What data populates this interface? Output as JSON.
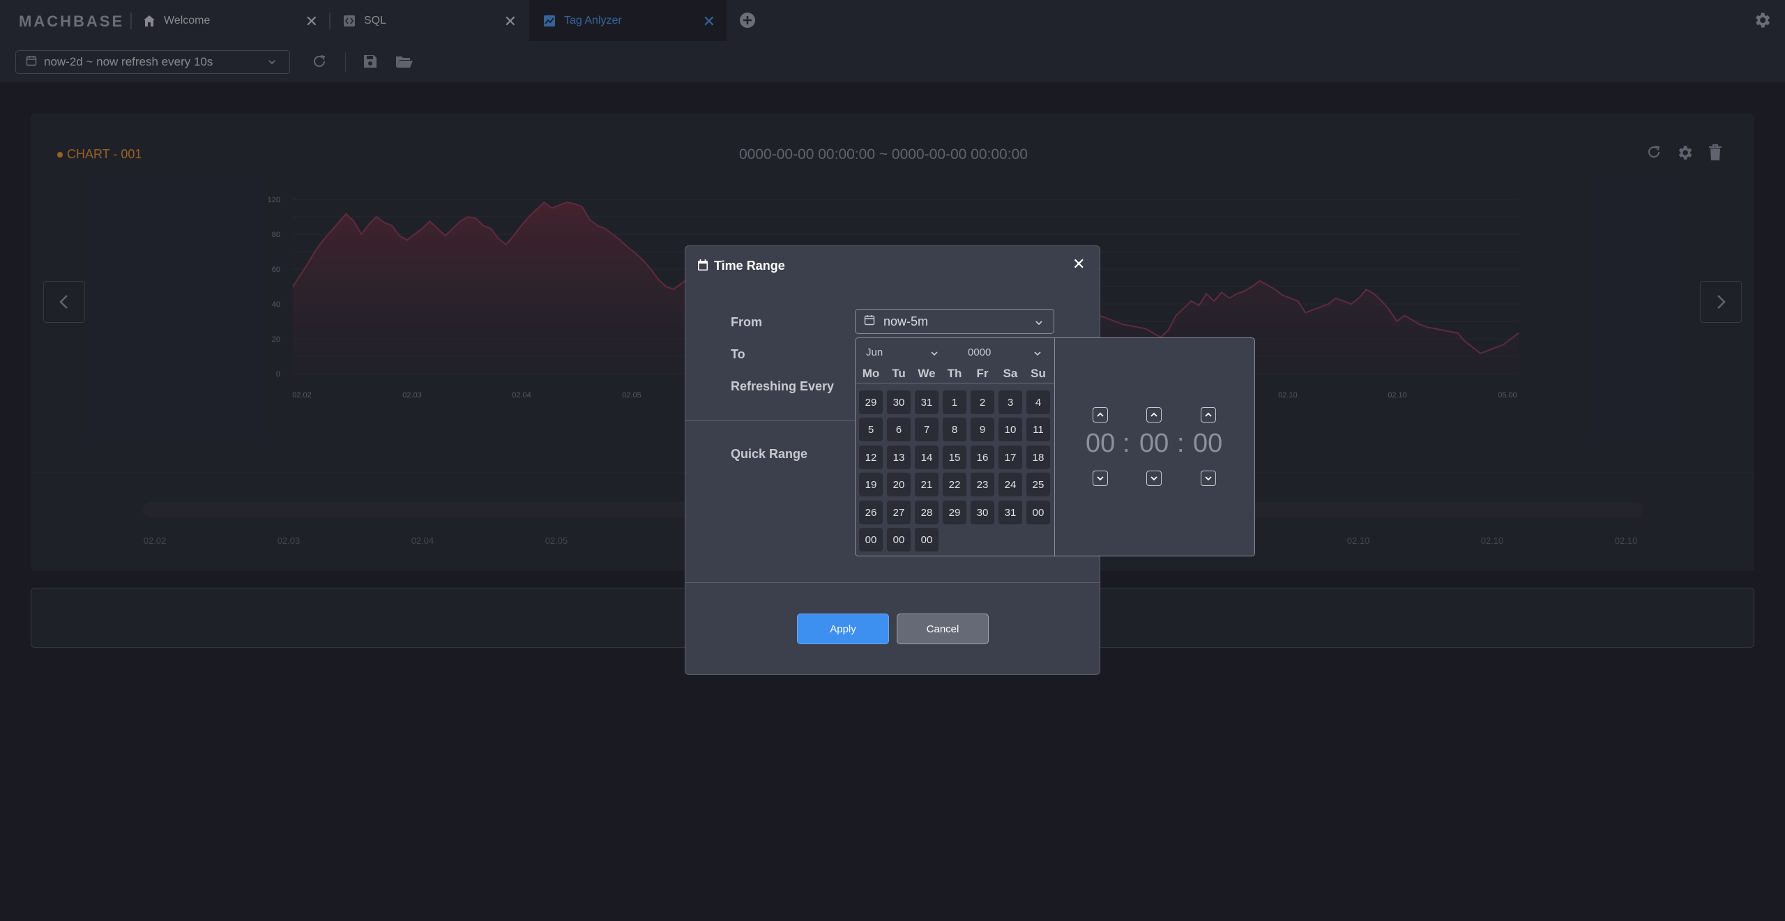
{
  "app": {
    "logo_text": "MACHBASE"
  },
  "tabs": [
    {
      "label": "Welcome",
      "icon": "home-icon",
      "active": false
    },
    {
      "label": "SQL",
      "icon": "sql-icon",
      "active": false
    },
    {
      "label": "Tag Anlyzer",
      "icon": "chart-icon",
      "active": true
    }
  ],
  "toolbar": {
    "range_label": "now-2d ~ now refresh every 10s"
  },
  "panel": {
    "title": "CHART - 001",
    "range_text": "0000-00-00 00:00:00 ~ 0000-00-00 00:00:00",
    "accent": "#e08a2e"
  },
  "chart_data": {
    "type": "area",
    "color": "#6b2c3c",
    "yticks": [
      "120",
      "80",
      "60",
      "40",
      "20",
      "0"
    ],
    "xticks": [
      "02.02",
      "02.03",
      "02.04",
      "02.05",
      "02.10",
      "02.10",
      "05.00"
    ],
    "navigator_ticks": [
      "02.02",
      "02.03",
      "02.04",
      "02.05",
      "02.10",
      "02.10",
      "02.10"
    ],
    "ylim": [
      0,
      120
    ],
    "series_values": [
      60,
      68,
      76,
      85,
      92,
      98,
      104,
      110,
      105,
      96,
      103,
      108,
      104,
      102,
      95,
      92,
      96,
      100,
      105,
      100,
      95,
      100,
      105,
      108,
      107,
      102,
      100,
      93,
      89,
      95,
      102,
      108,
      113,
      118,
      114,
      116,
      118,
      117,
      115,
      106,
      102,
      100,
      96,
      92,
      87,
      83,
      78,
      72,
      65,
      60,
      58,
      62,
      66,
      70,
      68,
      64,
      60,
      55,
      50,
      42,
      36,
      40,
      46,
      52,
      58,
      64,
      68,
      72,
      76,
      80,
      84,
      66,
      62,
      57,
      52,
      48,
      45,
      42,
      40,
      38,
      36,
      34,
      33,
      32,
      34,
      36,
      40,
      45,
      48,
      50,
      52,
      50,
      54,
      58,
      56,
      60,
      62,
      64,
      66,
      62,
      58,
      55,
      52,
      48,
      44,
      42,
      40,
      38,
      36,
      34,
      33,
      32,
      31,
      28,
      25,
      30,
      40,
      45,
      50,
      47,
      55,
      50,
      56,
      52,
      55,
      57,
      60,
      64,
      61,
      58,
      54,
      52,
      50,
      42,
      44,
      46,
      48,
      52,
      50,
      48,
      52,
      58,
      55,
      50,
      44,
      36,
      40,
      37,
      34,
      32,
      31,
      30,
      29,
      28,
      22,
      18,
      14,
      16,
      18,
      20,
      24,
      28
    ]
  },
  "dialog": {
    "title": "Time Range",
    "from_label": "From",
    "to_label": "To",
    "refresh_label": "Refreshing Every",
    "quick_range_label": "Quick Range",
    "from_value": "now-5m",
    "apply_label": "Apply",
    "cancel_label": "Cancel",
    "picker": {
      "month": "Jun",
      "year": "0000",
      "weekdays": [
        "Mo",
        "Tu",
        "We",
        "Th",
        "Fr",
        "Sa",
        "Su"
      ],
      "days": [
        [
          "29",
          "30",
          "31",
          "1",
          "2",
          "3",
          "4"
        ],
        [
          "5",
          "6",
          "7",
          "8",
          "9",
          "10",
          "11"
        ],
        [
          "12",
          "13",
          "14",
          "15",
          "16",
          "17",
          "18"
        ],
        [
          "19",
          "20",
          "21",
          "22",
          "23",
          "24",
          "25"
        ],
        [
          "26",
          "27",
          "28",
          "29",
          "30",
          "31",
          "00"
        ],
        [
          "00",
          "00",
          "00"
        ]
      ],
      "hours": "00",
      "minutes": "00",
      "seconds": "00"
    }
  }
}
